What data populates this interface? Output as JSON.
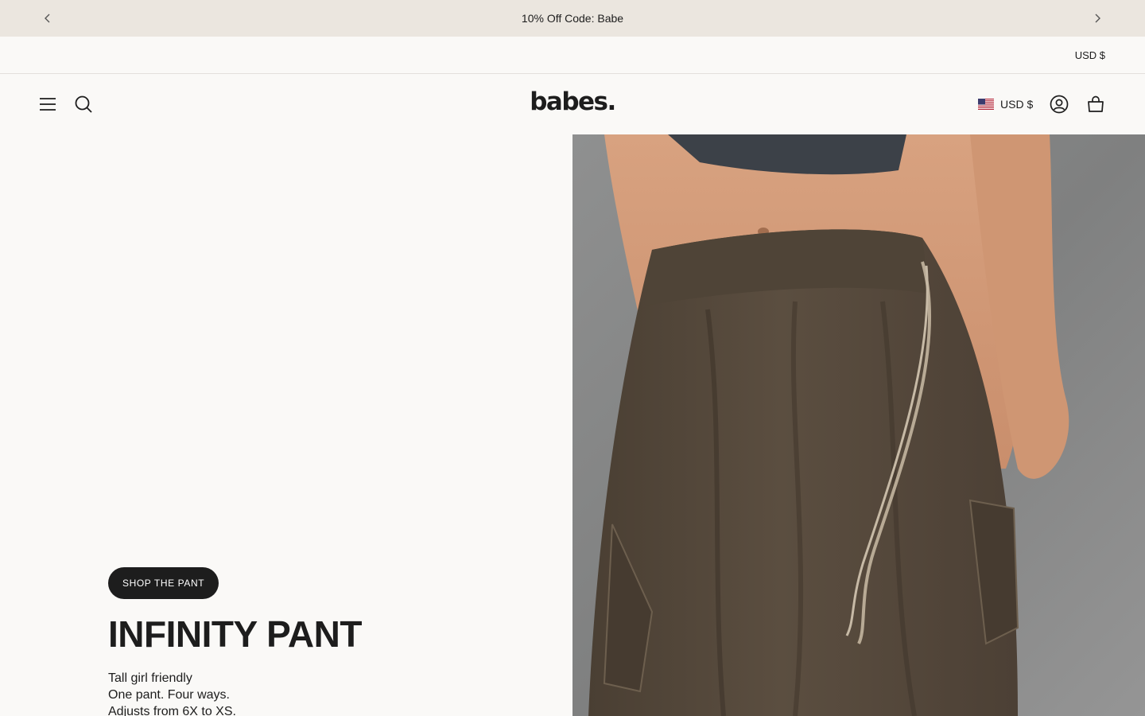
{
  "announcement": {
    "text": "10% Off Code: Babe",
    "prev_icon": "chevron-left-icon",
    "next_icon": "chevron-right-icon"
  },
  "utility_bar": {
    "currency": "USD $"
  },
  "header": {
    "logo": "babes.",
    "menu_icon": "hamburger-menu-icon",
    "search_icon": "search-icon",
    "currency": "USD $",
    "flag_icon": "us-flag-icon",
    "account_icon": "account-icon",
    "cart_icon": "shopping-bag-icon"
  },
  "hero": {
    "button_label": "SHOP THE PANT",
    "title": "INFINITY PANT",
    "lines": [
      "Tall girl friendly",
      "One pant. Four ways.",
      "Adjusts from 6X to XS."
    ]
  },
  "colors": {
    "announcement_bg": "#ebe6df",
    "page_bg": "#faf9f7",
    "text": "#1d1d1d",
    "button_bg": "#1d1d1d"
  }
}
